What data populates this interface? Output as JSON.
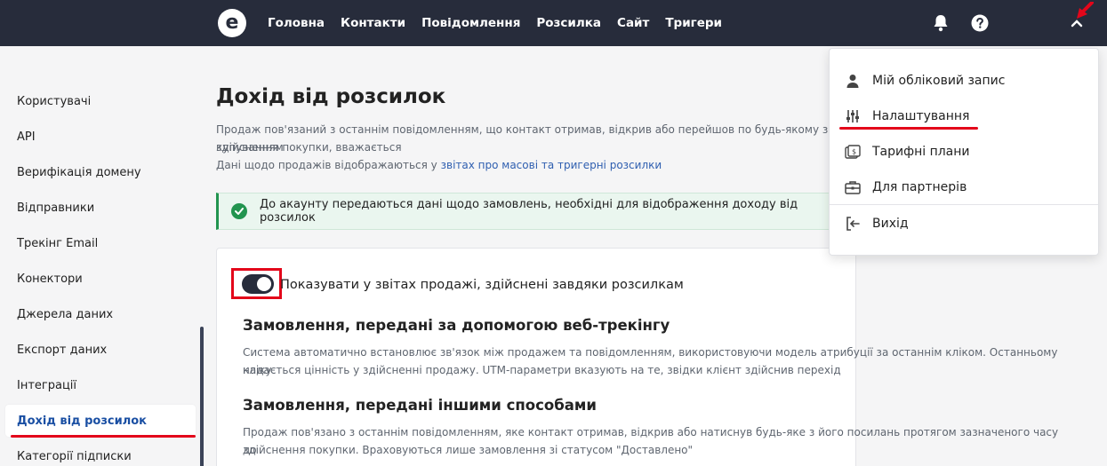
{
  "topbar": {
    "logo_letter": "e",
    "nav": [
      "Головна",
      "Контакти",
      "Повідомлення",
      "Розсилка",
      "Сайт",
      "Тригери"
    ]
  },
  "sidebar": {
    "items": [
      {
        "label": "Користувачі"
      },
      {
        "label": "API"
      },
      {
        "label": "Верифікація домену"
      },
      {
        "label": "Відправники"
      },
      {
        "label": "Трекінг Email"
      },
      {
        "label": "Конектори"
      },
      {
        "label": "Джерела даних"
      },
      {
        "label": "Експорт даних"
      },
      {
        "label": "Інтеграції"
      },
      {
        "label": "Дохід від розсилок"
      },
      {
        "label": "Категорії підписки"
      }
    ],
    "active_index": 9
  },
  "main": {
    "title": "Дохід від розсилок",
    "desc_line1": "Продаж пов'язаний з останнім повідомленням, що контакт отримав, відкрив або перейшов по будь-якому з посиланнь протягом зазначеного часу до здійснення покупки, вважається",
    "desc_line2": "купуванням",
    "desc_line3_prefix": "Дані щодо продажів відображаються у ",
    "desc_line3_link": "звітах про масові та тригерні розсилки",
    "alert_text": "До акаунту передаються дані щодо замовлень, необхідні для відображення доходу від розсилок",
    "toggle_label": "Показувати у звітах продажі, здійснені завдяки розсилкам",
    "toggle_on": true,
    "section1_title": "Замовлення, передані за допомогою веб-трекінгу",
    "section1_text1": "Система автоматично встановлює зв'язок між продажем та повідомленням, використовуючи модель атрибуції за останнім кліком. Останньому кліку",
    "section1_text2": "надається цінність у здійсненні продажу. UTM-параметри вказують на те, звідки клієнт здійснив перехід",
    "section2_title": "Замовлення, передані іншими способами",
    "section2_text1": "Продаж пов'язано з останнім повідомленням, яке контакт отримав, відкрив або натиснув будь-яке з його посилань протягом зазначеного часу до",
    "section2_text2": "здійснення покупки. Враховуються лише замовлення зі статусом \"Доставлено\""
  },
  "dropdown": {
    "items": [
      {
        "label": "Мій обліковий запис",
        "icon": "user-icon"
      },
      {
        "label": "Налаштування",
        "icon": "sliders-icon"
      },
      {
        "label": "Тарифні плани",
        "icon": "pricing-icon"
      },
      {
        "label": "Для партнерів",
        "icon": "briefcase-icon"
      },
      {
        "label": "Вихід",
        "icon": "logout-icon"
      }
    ]
  },
  "colors": {
    "topbar": "#272c3b",
    "highlight": "#e3061a",
    "link": "#2f5fb0",
    "success": "#22944f"
  }
}
